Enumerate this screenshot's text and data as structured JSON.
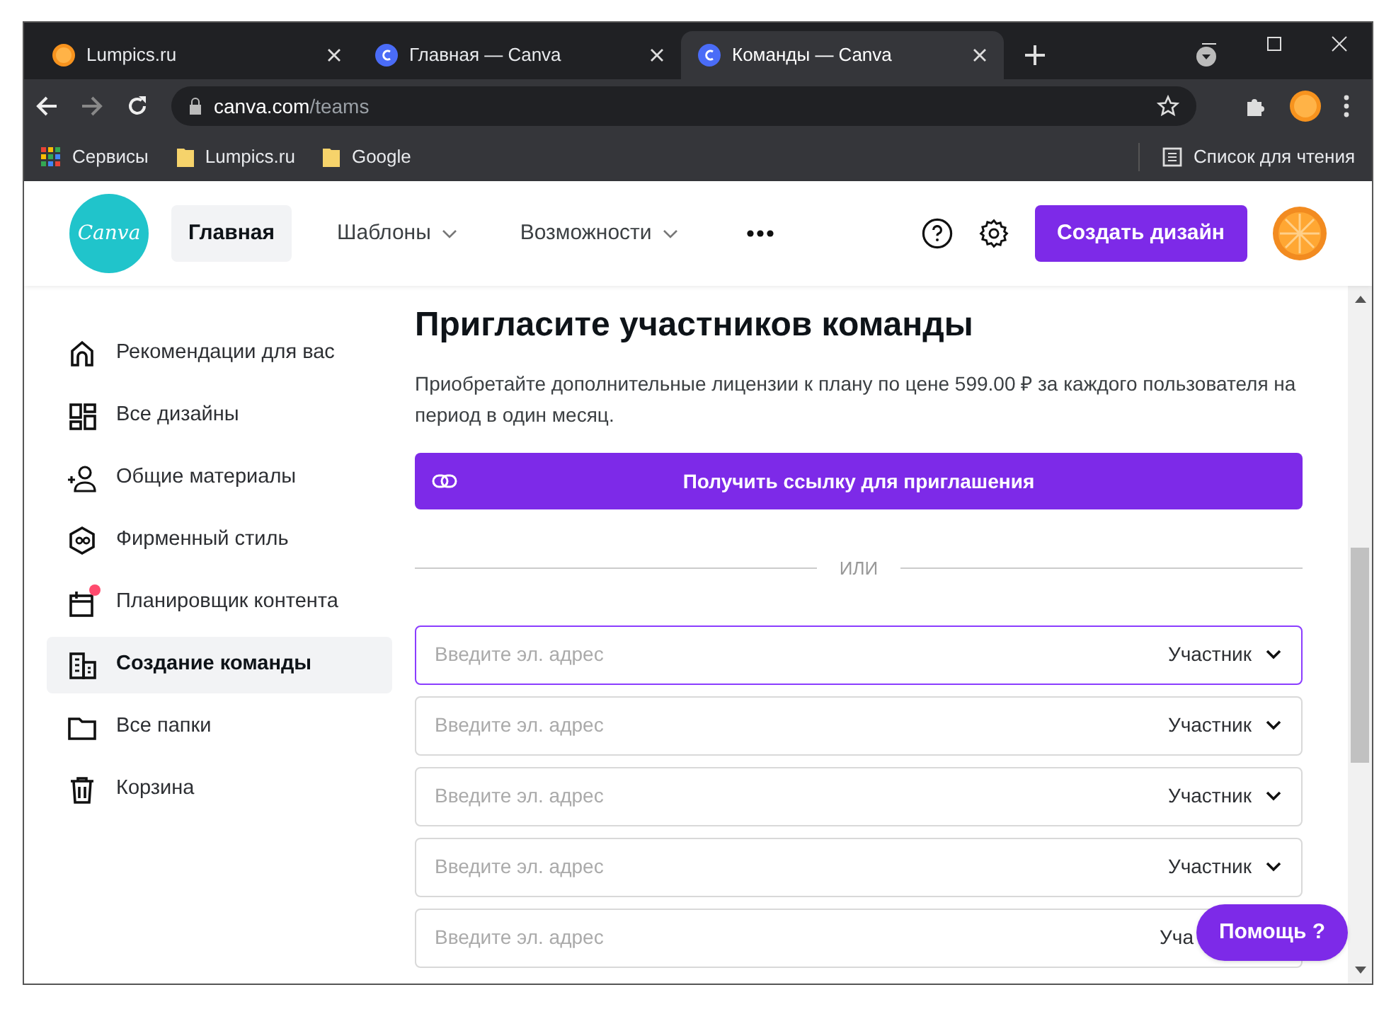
{
  "browser": {
    "tabs": [
      {
        "title": "Lumpics.ru",
        "kind": "fruit",
        "selected": false
      },
      {
        "title": "Главная — Canva",
        "kind": "letter",
        "selected": false
      },
      {
        "title": "Команды — Canva",
        "kind": "letter",
        "selected": true
      }
    ],
    "address": {
      "host": "canva.com",
      "path": "/teams"
    },
    "bookmarks": [
      {
        "label": "Сервисы",
        "kind": "apps"
      },
      {
        "label": "Lumpics.ru",
        "kind": "folder"
      },
      {
        "label": "Google",
        "kind": "folder"
      }
    ],
    "reading_list": "Список для чтения"
  },
  "header": {
    "logo": "Canva",
    "nav": [
      {
        "label": "Главная",
        "selected": true,
        "dropdown": false
      },
      {
        "label": "Шаблоны",
        "selected": false,
        "dropdown": true
      },
      {
        "label": "Возможности",
        "selected": false,
        "dropdown": true
      }
    ],
    "create_button": "Создать дизайн"
  },
  "sidebar": {
    "items": [
      {
        "label": "Рекомендации для вас",
        "kind": "home",
        "selected": false,
        "badge": false
      },
      {
        "label": "Все дизайны",
        "kind": "grid",
        "selected": false,
        "badge": false
      },
      {
        "label": "Общие материалы",
        "kind": "people",
        "selected": false,
        "badge": false
      },
      {
        "label": "Фирменный стиль",
        "kind": "brand",
        "selected": false,
        "badge": false
      },
      {
        "label": "Планировщик контента",
        "kind": "calendar",
        "selected": false,
        "badge": true
      },
      {
        "label": "Создание команды",
        "kind": "building",
        "selected": true,
        "badge": false
      },
      {
        "label": "Все папки",
        "kind": "folder",
        "selected": false,
        "badge": false
      },
      {
        "label": "Корзина",
        "kind": "trash",
        "selected": false,
        "badge": false
      }
    ]
  },
  "main": {
    "title": "Пригласите участников команды",
    "description": "Приобретайте дополнительные лицензии к плану по цене 599.00 ₽ за каждого пользователя на период в один месяц.",
    "link_button": "Получить ссылку для приглашения",
    "divider": "ИЛИ",
    "invites": [
      {
        "placeholder": "Введите эл. адрес",
        "role": "Участник",
        "focused": true,
        "partly_hidden": false
      },
      {
        "placeholder": "Введите эл. адрес",
        "role": "Участник",
        "focused": false,
        "partly_hidden": false
      },
      {
        "placeholder": "Введите эл. адрес",
        "role": "Участник",
        "focused": false,
        "partly_hidden": false
      },
      {
        "placeholder": "Введите эл. адрес",
        "role": "Участник",
        "focused": false,
        "partly_hidden": false
      },
      {
        "placeholder": "Введите эл. адрес",
        "role": "Уча",
        "focused": false,
        "partly_hidden": true
      }
    ]
  },
  "help_button": "Помощь ?"
}
